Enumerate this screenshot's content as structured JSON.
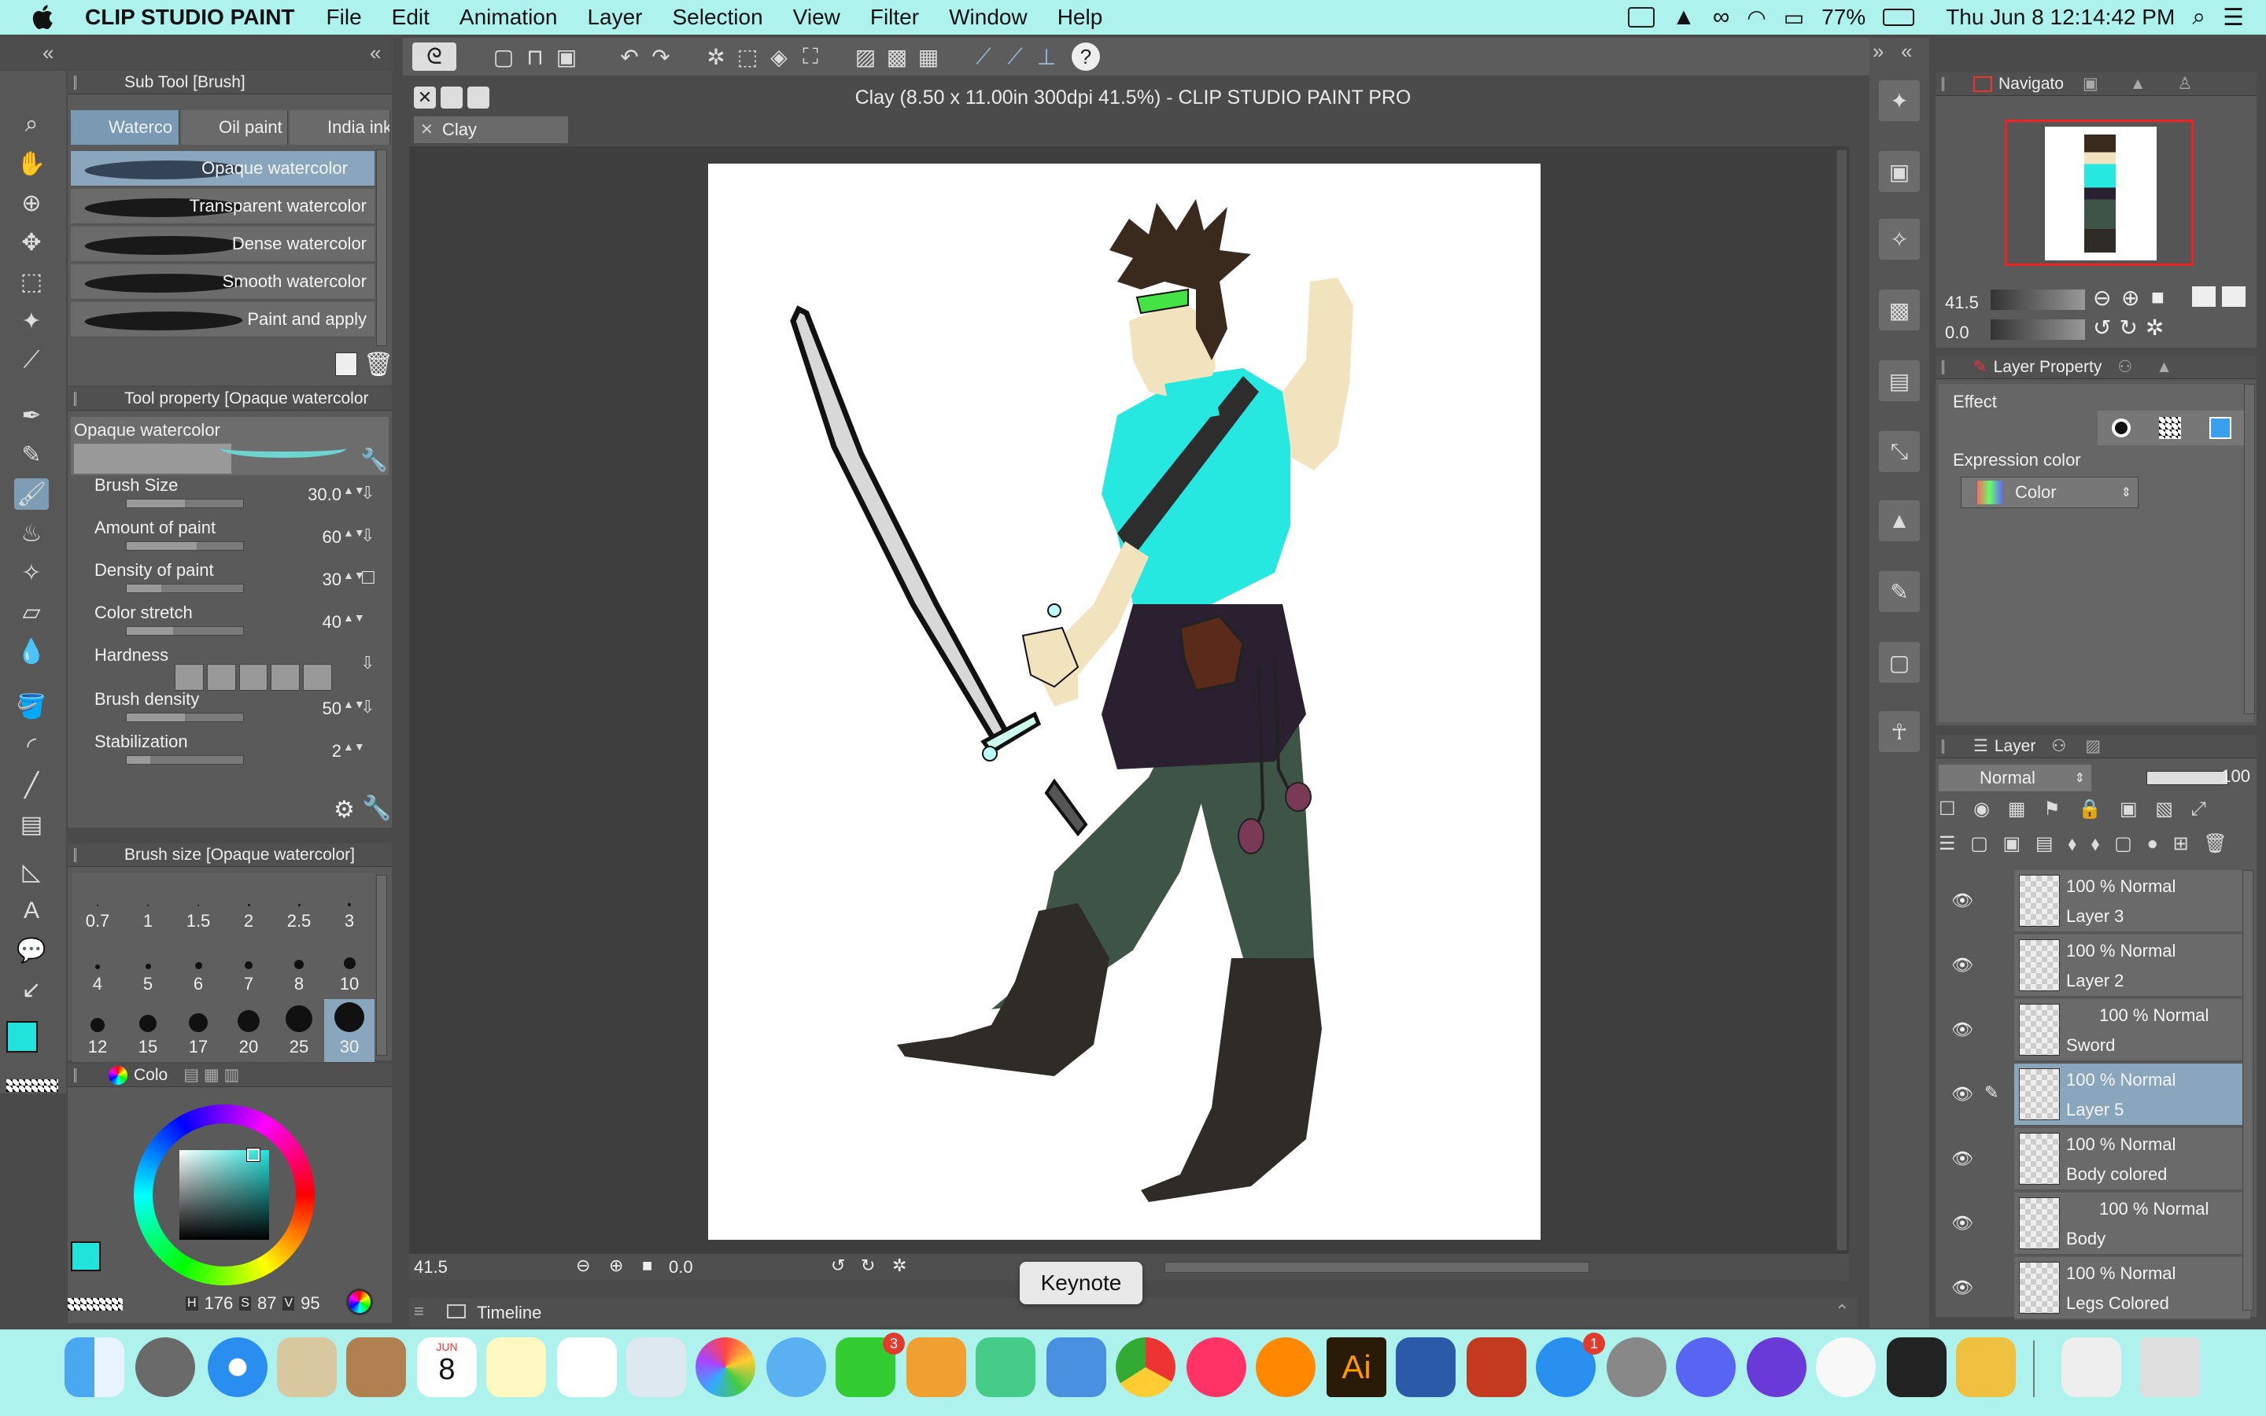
{
  "menubar": {
    "app_name": "CLIP STUDIO PAINT",
    "items": [
      "File",
      "Edit",
      "Animation",
      "Layer",
      "Selection",
      "View",
      "Filter",
      "Window",
      "Help"
    ],
    "battery": "77%",
    "datetime": "Thu Jun 8  12:14:42 PM"
  },
  "document": {
    "title": "Clay (8.50 x 11.00in 300dpi 41.5%)  - CLIP STUDIO PAINT PRO",
    "tab": "Clay"
  },
  "subtool": {
    "header": "Sub Tool [Brush]",
    "tabs": [
      "Waterco",
      "Oil paint",
      "India ink"
    ],
    "brushes": [
      "Opaque watercolor",
      "Transparent watercolor",
      "Dense watercolor",
      "Smooth watercolor",
      "Paint and apply"
    ]
  },
  "toolprop": {
    "header": "Tool property [Opaque watercolor",
    "preset": "Opaque watercolor",
    "props": [
      {
        "label": "Brush Size",
        "value": "30.0",
        "fill": 0.5
      },
      {
        "label": "Amount of paint",
        "value": "60",
        "fill": 0.6
      },
      {
        "label": "Density of paint",
        "value": "30",
        "fill": 0.3
      },
      {
        "label": "Color stretch",
        "value": "40",
        "fill": 0.4
      },
      {
        "label": "Hardness",
        "value": "",
        "fill": 0
      },
      {
        "label": "Brush density",
        "value": "50",
        "fill": 0.5
      },
      {
        "label": "Stabilization",
        "value": "2",
        "fill": 0.2
      }
    ]
  },
  "brushsize": {
    "header": "Brush size [Opaque watercolor]",
    "sizes": [
      "0.7",
      "1",
      "1.5",
      "2",
      "2.5",
      "3",
      "4",
      "5",
      "6",
      "7",
      "8",
      "10",
      "12",
      "15",
      "17",
      "20",
      "25",
      "30"
    ]
  },
  "color": {
    "header": "Colo",
    "h": "176",
    "s": "87",
    "v": "95",
    "h_label": "H",
    "s_label": "S",
    "v_label": "V",
    "main_color": "#22e3dc"
  },
  "canvas_status": {
    "zoom": "41.5",
    "angle": "0.0"
  },
  "timeline": {
    "label": "Timeline"
  },
  "navigator": {
    "header": "Navigato",
    "zoom": "41.5",
    "angle": "0.0"
  },
  "layerprop": {
    "header": "Layer Property",
    "effect": "Effect",
    "expression_color_label": "Expression color",
    "expression_color": "Color"
  },
  "layers": {
    "header": "Layer",
    "blend": "Normal",
    "opacity": "100",
    "items": [
      {
        "mode": "100 % Normal",
        "name": "Layer 3"
      },
      {
        "mode": "100 % Normal",
        "name": "Layer 2"
      },
      {
        "mode": "100 % Normal",
        "name": "Sword"
      },
      {
        "mode": "100 % Normal",
        "name": "Layer 5"
      },
      {
        "mode": "100 % Normal",
        "name": "Body colored"
      },
      {
        "mode": "100 % Normal",
        "name": "Body"
      },
      {
        "mode": "100 % Normal",
        "name": "Legs Colored"
      }
    ]
  },
  "dock": {
    "tooltip": "Keynote",
    "calendar_month": "JUN",
    "calendar_day": "8",
    "facetime_badge": "3",
    "appstore_badge": "1",
    "illustrator_label": "Ai"
  }
}
